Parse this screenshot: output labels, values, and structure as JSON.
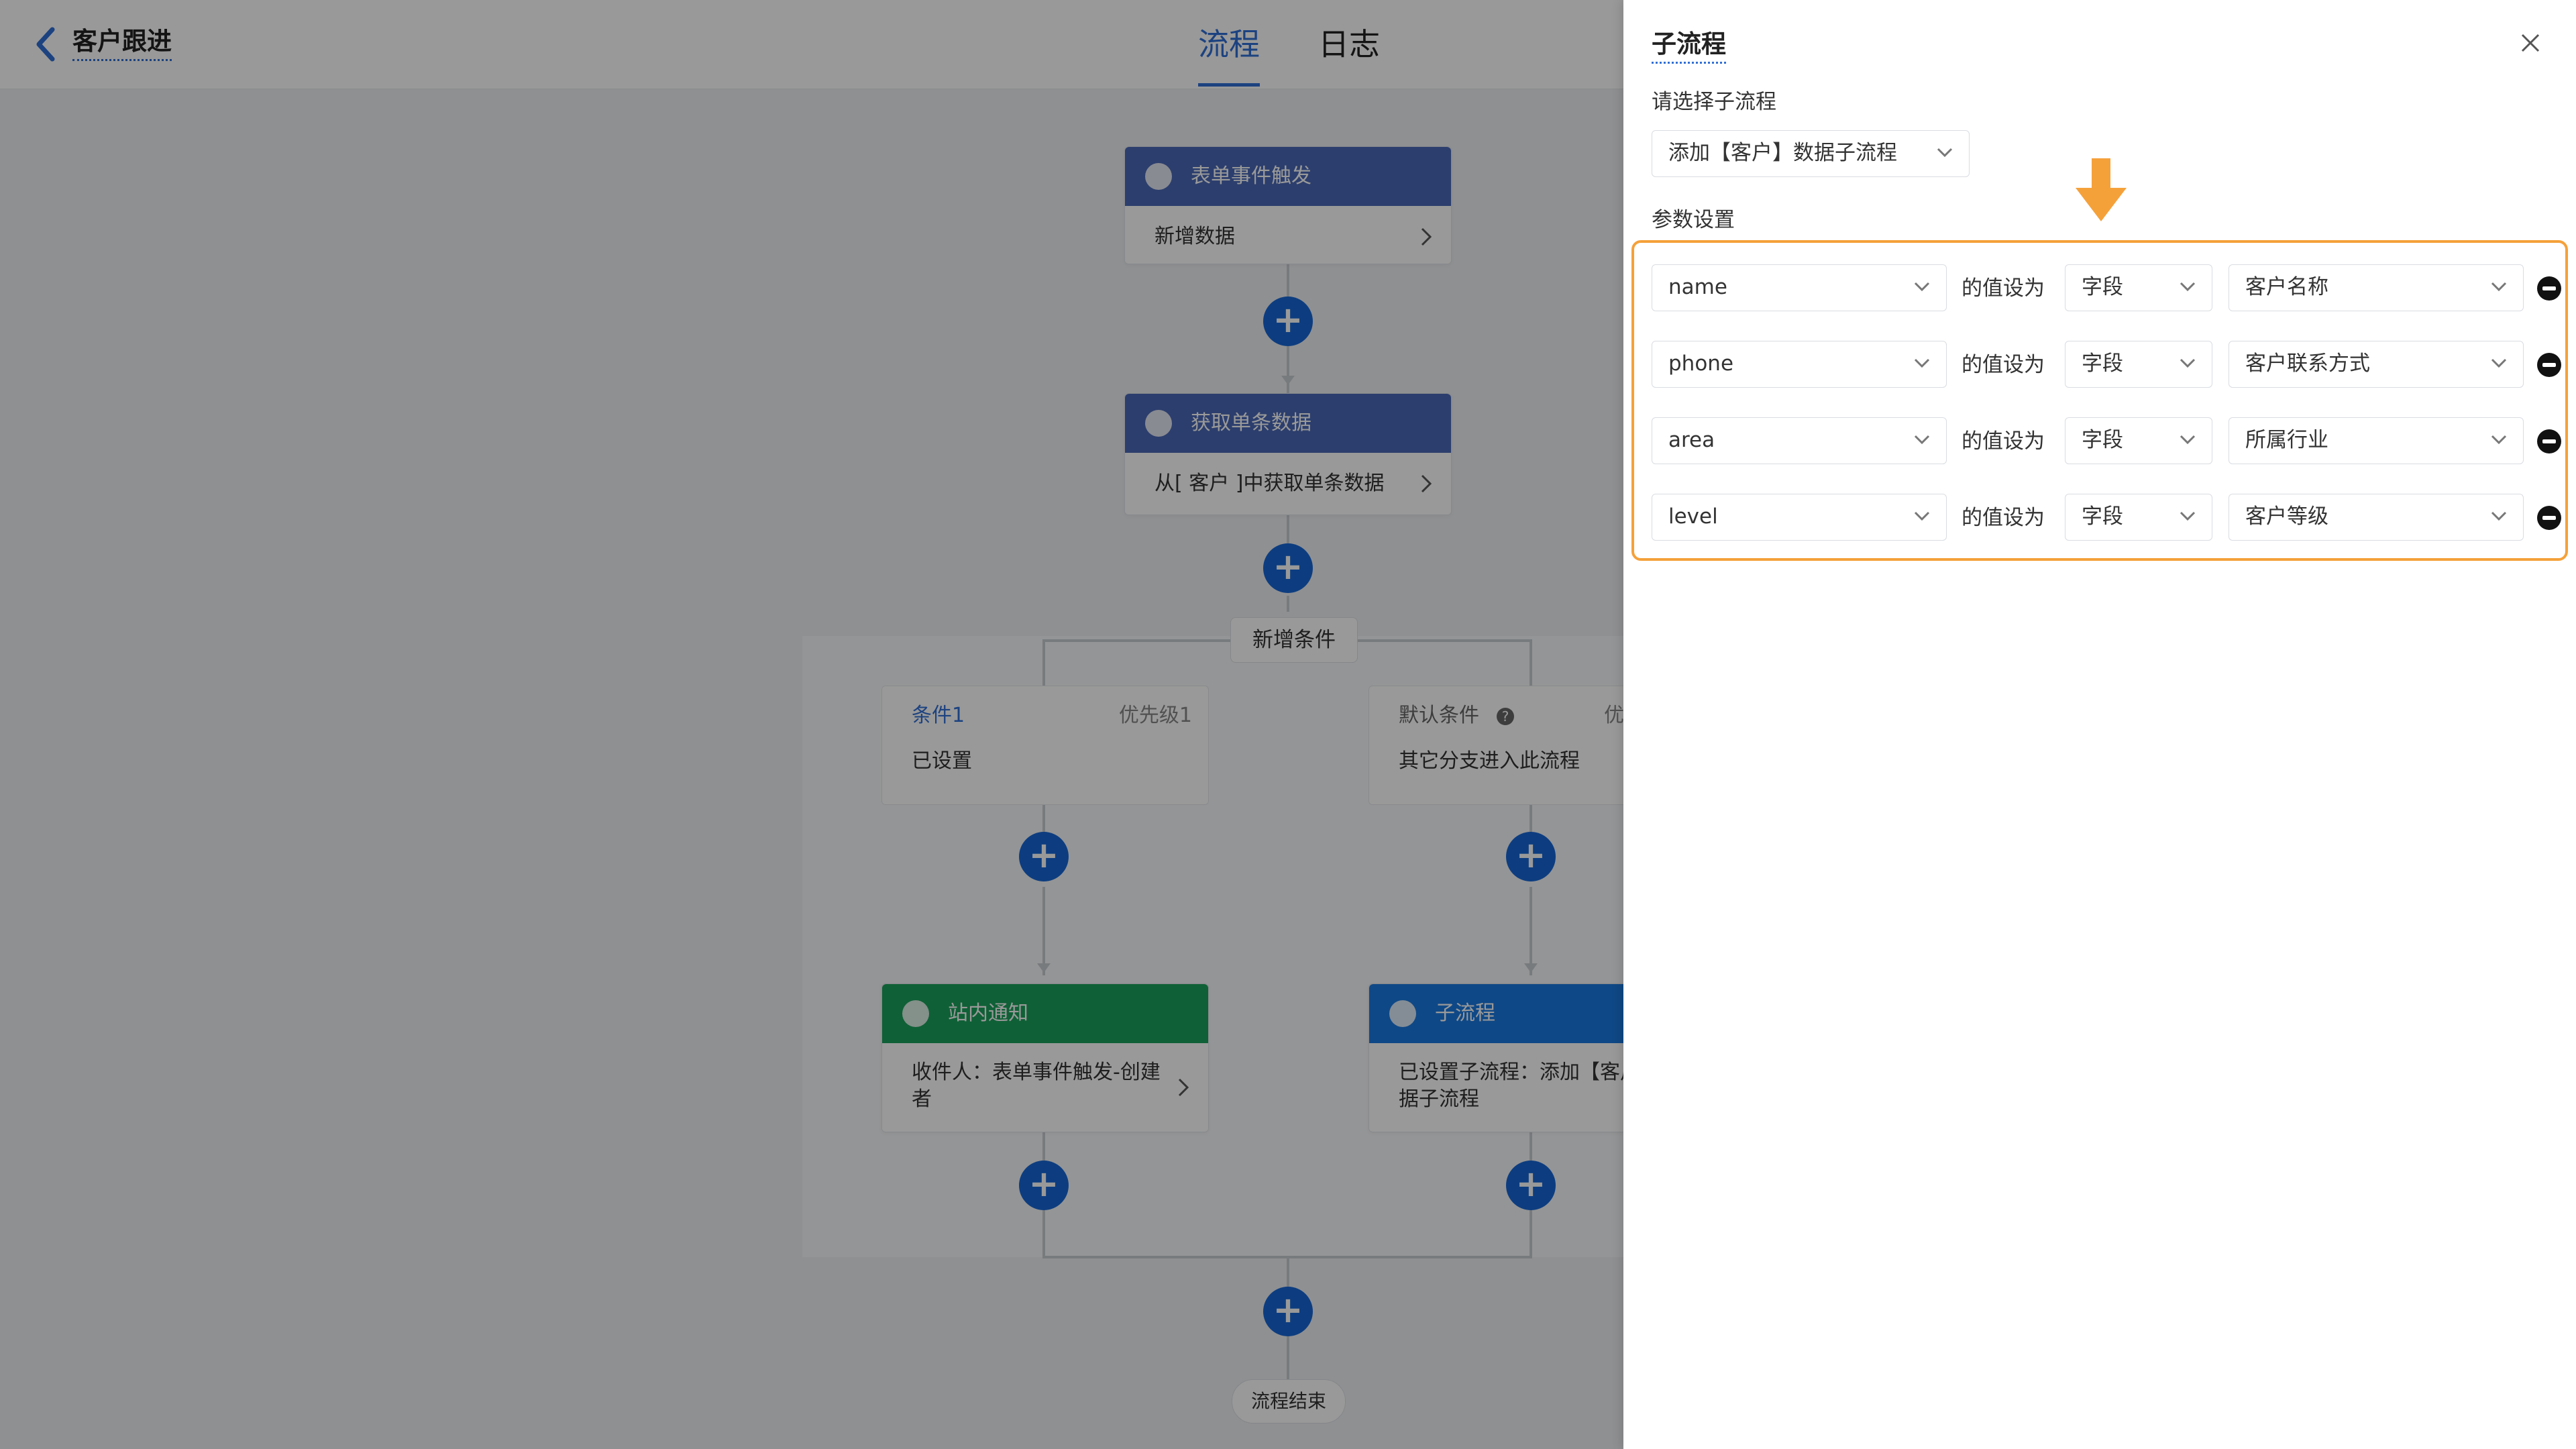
{
  "header": {
    "back_icon": "chevron-left-icon",
    "title": "客户跟进",
    "tabs": [
      {
        "label": "流程",
        "active": true
      },
      {
        "label": "日志",
        "active": false
      }
    ]
  },
  "flow": {
    "trigger_node": {
      "title": "表单事件触发",
      "body": "新增数据"
    },
    "fetch_node": {
      "title": "获取单条数据",
      "body": "从[ 客户 ]中获取单条数据"
    },
    "add_condition_label": "新增条件",
    "condition1": {
      "name": "条件1",
      "priority": "优先级1",
      "status": "已设置"
    },
    "default_condition": {
      "name": "默认条件",
      "priority": "优",
      "desc": "其它分支进入此流程"
    },
    "notify_node": {
      "title": "站内通知",
      "body": "收件人：表单事件触发-创建者"
    },
    "subflow_node": {
      "title": "子流程",
      "body": "已设置子流程：添加【客户】数据子流程"
    },
    "end_label": "流程结束"
  },
  "panel": {
    "title": "子流程",
    "close_icon": "close-icon",
    "select_label": "请选择子流程",
    "selected_subflow": "添加【客户】数据子流程",
    "params_label": "参数设置",
    "params": [
      {
        "field": "name",
        "connector": "的值设为",
        "type": "字段",
        "value": "客户名称"
      },
      {
        "field": "phone",
        "connector": "的值设为",
        "type": "字段",
        "value": "客户联系方式"
      },
      {
        "field": "area",
        "connector": "的值设为",
        "type": "字段",
        "value": "所属行业"
      },
      {
        "field": "level",
        "connector": "的值设为",
        "type": "字段",
        "value": "客户等级"
      }
    ]
  },
  "colors": {
    "accent": "#2f6fd6",
    "plus_button": "#1766d6",
    "node_header_default": "#4a68b6",
    "node_header_notify": "#1aa05a",
    "node_header_subflow": "#1a78e0",
    "highlight": "#f5a13a"
  }
}
